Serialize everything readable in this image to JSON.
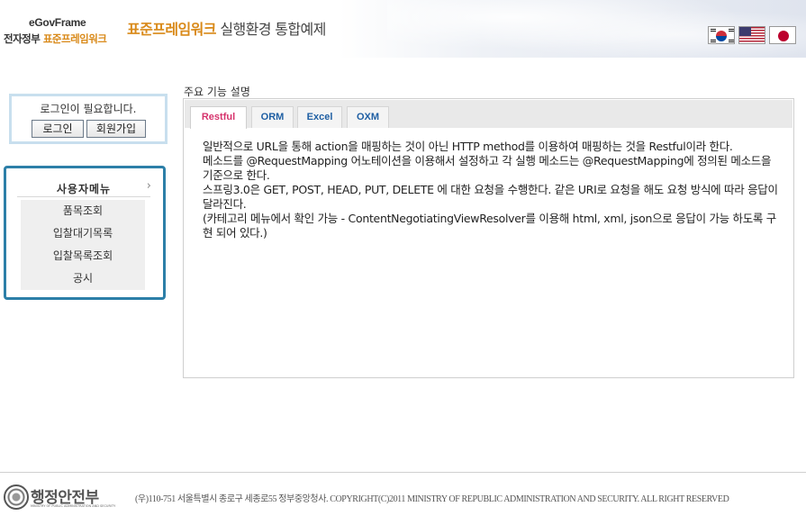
{
  "header": {
    "logo_top": "eGovFrame",
    "logo_bottom_plain": "전자정부 ",
    "logo_bottom_accent": "표준프레임워크",
    "title_accent": "표준프레임워크",
    "title_rest": " 실행환경 통합예제",
    "flags": [
      "korea-flag",
      "usa-flag",
      "japan-flag"
    ],
    "accent_color": "#d98a1a"
  },
  "login": {
    "message": "로그인이 필요합니다.",
    "login_label": "로그인",
    "join_label": "회원가입"
  },
  "user_menu": {
    "title": "사용자메뉴",
    "chevron": "›",
    "items": [
      "품목조회",
      "입찰대기목록",
      "입찰목록조회",
      "공시"
    ]
  },
  "main": {
    "section_label": "주요 기능 설명",
    "tabs": [
      {
        "label": "Restful",
        "active": true
      },
      {
        "label": "ORM",
        "active": false
      },
      {
        "label": "Excel",
        "active": false
      },
      {
        "label": "OXM",
        "active": false
      }
    ],
    "content_lines": [
      "일반적으로 URL을 통해 action을 매핑하는 것이 아닌 HTTP method를 이용하여 매핑하는 것을 Restful이라 한다.",
      "메소드를 @RequestMapping 어노테이션을 이용해서 설정하고 각 실행 메소드는 @RequestMapping에 정의된 메소드을 기준으로 한다.",
      "스프링3.0은 GET, POST, HEAD, PUT, DELETE 에 대한 요청을 수행한다. 같은 URI로 요청을 해도 요청 방식에 따라 응답이 달라진다.",
      "(카테고리 메뉴에서 확인 가능 - ContentNegotiatingViewResolver를 이용해 html, xml, json으로 응답이 가능 하도록 구현 되어 있다.)"
    ]
  },
  "footer": {
    "logo_text": "행정안전부",
    "logo_sub": "MINISTRY OF PUBLIC ADMINISTRATION AND SECURITY",
    "copyright": "(우)110-751 서울특별시 종로구 세종로55 정부중앙청사. COPYRIGHT(C)2011 MINISTRY OF REPUBLIC ADMINISTRATION AND SECURITY. ALL RIGHT RESERVED"
  }
}
